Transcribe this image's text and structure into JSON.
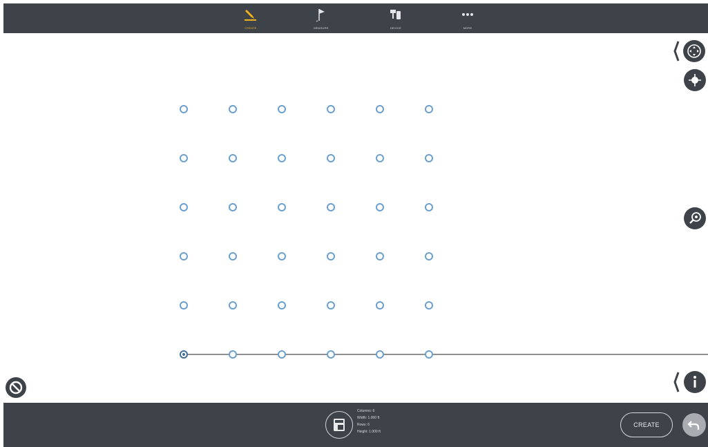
{
  "toolbar": {
    "tabs": [
      {
        "label": "CREATE",
        "icon": "pencil-icon",
        "active": true
      },
      {
        "label": "MEASURE",
        "icon": "flag-icon",
        "active": false
      },
      {
        "label": "DEVICE",
        "icon": "device-icon",
        "active": false
      },
      {
        "label": "MORE",
        "icon": "more-icon",
        "active": false
      }
    ]
  },
  "grid": {
    "columns": 6,
    "rows": 6,
    "selected_point": "bottom-left"
  },
  "right_controls": [
    "move-icon",
    "center-icon",
    "zoom-icon",
    "info-icon"
  ],
  "bottom": {
    "info_lines": [
      "Columns: 6",
      "Width: 1.000 ft",
      "Rows: 6",
      "Height: 1.000 ft"
    ],
    "create_label": "CREATE"
  },
  "colors": {
    "bar": "#3e4249",
    "accent": "#f2b21b",
    "point": "#6b9fd0"
  }
}
